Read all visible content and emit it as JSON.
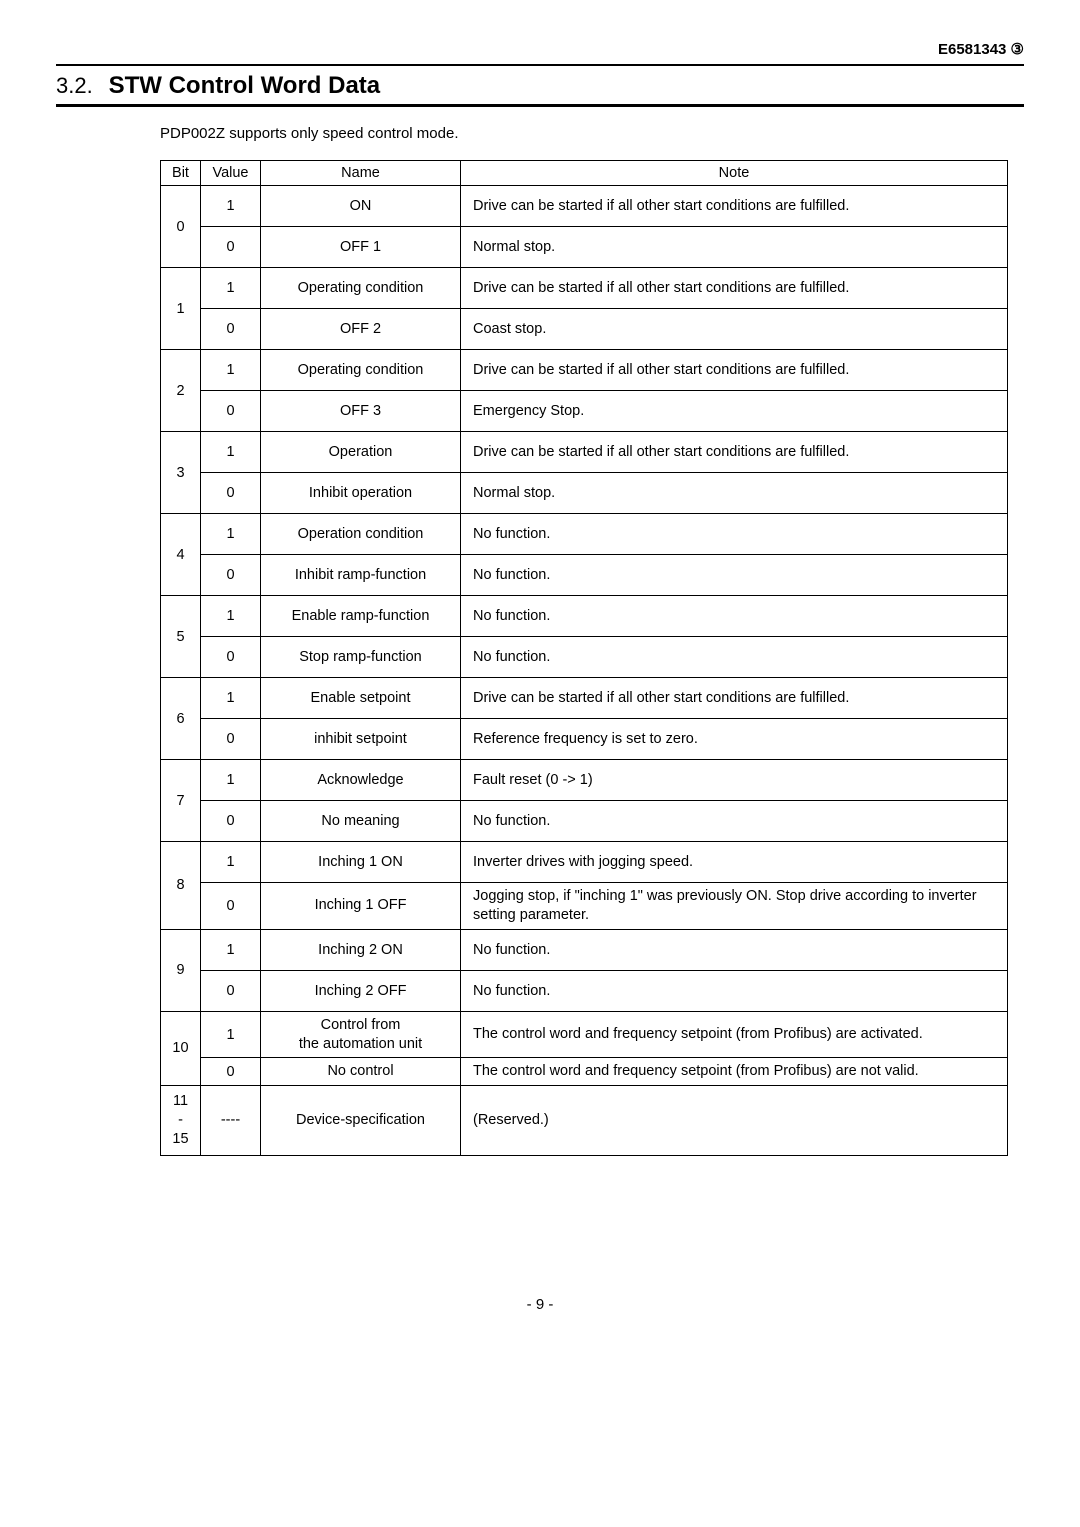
{
  "doc_code": "E6581343  ③",
  "section": {
    "number": "3.2.",
    "title": "STW Control Word Data"
  },
  "intro": "PDP002Z supports only speed control mode.",
  "table": {
    "headers": {
      "bit": "Bit",
      "value": "Value",
      "name": "Name",
      "note": "Note"
    },
    "rows": [
      {
        "bit": "0",
        "value": "1",
        "name": "ON",
        "note": "Drive can be started if all other start conditions are fulfilled."
      },
      {
        "bit": "0",
        "value": "0",
        "name": "OFF 1",
        "note": "Normal stop."
      },
      {
        "bit": "1",
        "value": "1",
        "name": "Operating condition",
        "note": "Drive can be started if all other start conditions are fulfilled."
      },
      {
        "bit": "1",
        "value": "0",
        "name": "OFF 2",
        "note": "Coast stop."
      },
      {
        "bit": "2",
        "value": "1",
        "name": "Operating condition",
        "note": "Drive can be started if all other start conditions are fulfilled."
      },
      {
        "bit": "2",
        "value": "0",
        "name": "OFF 3",
        "note": "Emergency Stop."
      },
      {
        "bit": "3",
        "value": "1",
        "name": "Operation",
        "note": "Drive can be started if all other start conditions are fulfilled."
      },
      {
        "bit": "3",
        "value": "0",
        "name": "Inhibit operation",
        "note": "Normal stop."
      },
      {
        "bit": "4",
        "value": "1",
        "name": "Operation condition",
        "note": "No function."
      },
      {
        "bit": "4",
        "value": "0",
        "name": "Inhibit ramp-function",
        "note": "No function."
      },
      {
        "bit": "5",
        "value": "1",
        "name": "Enable ramp-function",
        "note": "No function."
      },
      {
        "bit": "5",
        "value": "0",
        "name": "Stop ramp-function",
        "note": "No function."
      },
      {
        "bit": "6",
        "value": "1",
        "name": "Enable setpoint",
        "note": "Drive can be started if all other start conditions are fulfilled."
      },
      {
        "bit": "6",
        "value": "0",
        "name": "inhibit setpoint",
        "note": "Reference frequency is set to zero."
      },
      {
        "bit": "7",
        "value": "1",
        "name": "Acknowledge",
        "note": "Fault reset (0 -> 1)"
      },
      {
        "bit": "7",
        "value": "0",
        "name": "No meaning",
        "note": "No function."
      },
      {
        "bit": "8",
        "value": "1",
        "name": "Inching 1 ON",
        "note": "Inverter drives with jogging speed."
      },
      {
        "bit": "8",
        "value": "0",
        "name": "Inching 1 OFF",
        "note": "Jogging stop, if \"inching 1\" was previously ON. Stop drive according to inverter setting parameter."
      },
      {
        "bit": "9",
        "value": "1",
        "name": "Inching 2 ON",
        "note": "No function."
      },
      {
        "bit": "9",
        "value": "0",
        "name": "Inching 2 OFF",
        "note": "No function."
      },
      {
        "bit": "10",
        "value": "1",
        "name": "Control from\nthe automation unit",
        "note": "The control word and frequency setpoint (from Profibus) are activated."
      },
      {
        "bit": "10",
        "value": "0",
        "name": "No control",
        "note": "The control word and frequency setpoint (from Profibus) are not valid."
      },
      {
        "bit": "11\n-\n15",
        "value": "----",
        "name": "Device-specification",
        "note": "(Reserved.)"
      }
    ]
  },
  "page_number": "- 9 -"
}
